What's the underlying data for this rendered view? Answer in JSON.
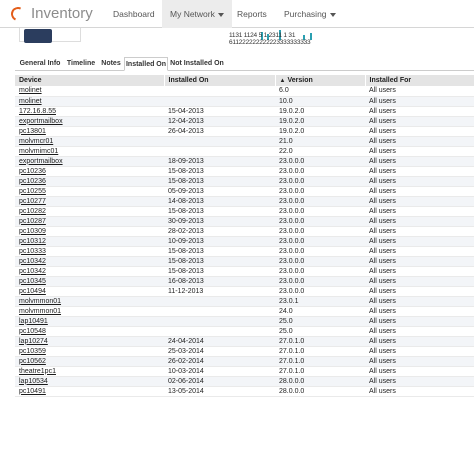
{
  "app": {
    "brand": "Inventory"
  },
  "nav": {
    "dashboard": "Dashboard",
    "my_network": "My Network",
    "reports": "Reports",
    "purchasing": "Purchasing"
  },
  "mini_chart": {
    "row1": "1131 1124 5 1 2311 1 31",
    "row2": "611222222222223333333333"
  },
  "tabs": [
    "General Info",
    "Timeline",
    "Notes",
    "Installed On",
    "Not Installed On"
  ],
  "active_tab": "Installed On",
  "table": {
    "headers": {
      "device": "Device",
      "installed_on": "Installed On",
      "version": "Version",
      "installed_for": "Installed For"
    },
    "sort_indicator": "▲",
    "rows": [
      {
        "device": "molinet",
        "installed_on": "",
        "version": "6.0",
        "installed_for": "All users"
      },
      {
        "device": "molinet",
        "installed_on": "",
        "version": "10.0",
        "installed_for": "All users"
      },
      {
        "device": "172.16.8.55",
        "installed_on": "15-04-2013",
        "version": "19.0.2.0",
        "installed_for": "All users"
      },
      {
        "device": "exportmailbox",
        "installed_on": "12-04-2013",
        "version": "19.0.2.0",
        "installed_for": "All users"
      },
      {
        "device": "pc13801",
        "installed_on": "26-04-2013",
        "version": "19.0.2.0",
        "installed_for": "All users"
      },
      {
        "device": "molvmcr01",
        "installed_on": "",
        "version": "21.0",
        "installed_for": "All users"
      },
      {
        "device": "molvmimc01",
        "installed_on": "",
        "version": "22.0",
        "installed_for": "All users"
      },
      {
        "device": "exportmailbox",
        "installed_on": "18-09-2013",
        "version": "23.0.0.0",
        "installed_for": "All users"
      },
      {
        "device": "pc10236",
        "installed_on": "15-08-2013",
        "version": "23.0.0.0",
        "installed_for": "All users"
      },
      {
        "device": "pc10236",
        "installed_on": "15-08-2013",
        "version": "23.0.0.0",
        "installed_for": "All users"
      },
      {
        "device": "pc10255",
        "installed_on": "05-09-2013",
        "version": "23.0.0.0",
        "installed_for": "All users"
      },
      {
        "device": "pc10277",
        "installed_on": "14-08-2013",
        "version": "23.0.0.0",
        "installed_for": "All users"
      },
      {
        "device": "pc10282",
        "installed_on": "15-08-2013",
        "version": "23.0.0.0",
        "installed_for": "All users"
      },
      {
        "device": "pc10287",
        "installed_on": "30-09-2013",
        "version": "23.0.0.0",
        "installed_for": "All users"
      },
      {
        "device": "pc10309",
        "installed_on": "28-02-2013",
        "version": "23.0.0.0",
        "installed_for": "All users"
      },
      {
        "device": "pc10312",
        "installed_on": "10-09-2013",
        "version": "23.0.0.0",
        "installed_for": "All users"
      },
      {
        "device": "pc10333",
        "installed_on": "15-08-2013",
        "version": "23.0.0.0",
        "installed_for": "All users"
      },
      {
        "device": "pc10342",
        "installed_on": "15-08-2013",
        "version": "23.0.0.0",
        "installed_for": "All users"
      },
      {
        "device": "pc10342",
        "installed_on": "15-08-2013",
        "version": "23.0.0.0",
        "installed_for": "All users"
      },
      {
        "device": "pc10345",
        "installed_on": "16-08-2013",
        "version": "23.0.0.0",
        "installed_for": "All users"
      },
      {
        "device": "pc10494",
        "installed_on": "11-12-2013",
        "version": "23.0.0.0",
        "installed_for": "All users"
      },
      {
        "device": "molvmmon01",
        "installed_on": "",
        "version": "23.0.1",
        "installed_for": "All users"
      },
      {
        "device": "molvmmon01",
        "installed_on": "",
        "version": "24.0",
        "installed_for": "All users"
      },
      {
        "device": "lap10491",
        "installed_on": "",
        "version": "25.0",
        "installed_for": "All users"
      },
      {
        "device": "pc10548",
        "installed_on": "",
        "version": "25.0",
        "installed_for": "All users"
      },
      {
        "device": "lap10274",
        "installed_on": "24-04-2014",
        "version": "27.0.1.0",
        "installed_for": "All users"
      },
      {
        "device": "pc10359",
        "installed_on": "25-03-2014",
        "version": "27.0.1.0",
        "installed_for": "All users"
      },
      {
        "device": "pc10562",
        "installed_on": "26-02-2014",
        "version": "27.0.1.0",
        "installed_for": "All users"
      },
      {
        "device": "theatre1pc1",
        "installed_on": "10-03-2014",
        "version": "27.0.1.0",
        "installed_for": "All users"
      },
      {
        "device": "lap10534",
        "installed_on": "02-06-2014",
        "version": "28.0.0.0",
        "installed_for": "All users"
      },
      {
        "device": "pc10491",
        "installed_on": "13-05-2014",
        "version": "28.0.0.0",
        "installed_for": "All users"
      }
    ]
  }
}
